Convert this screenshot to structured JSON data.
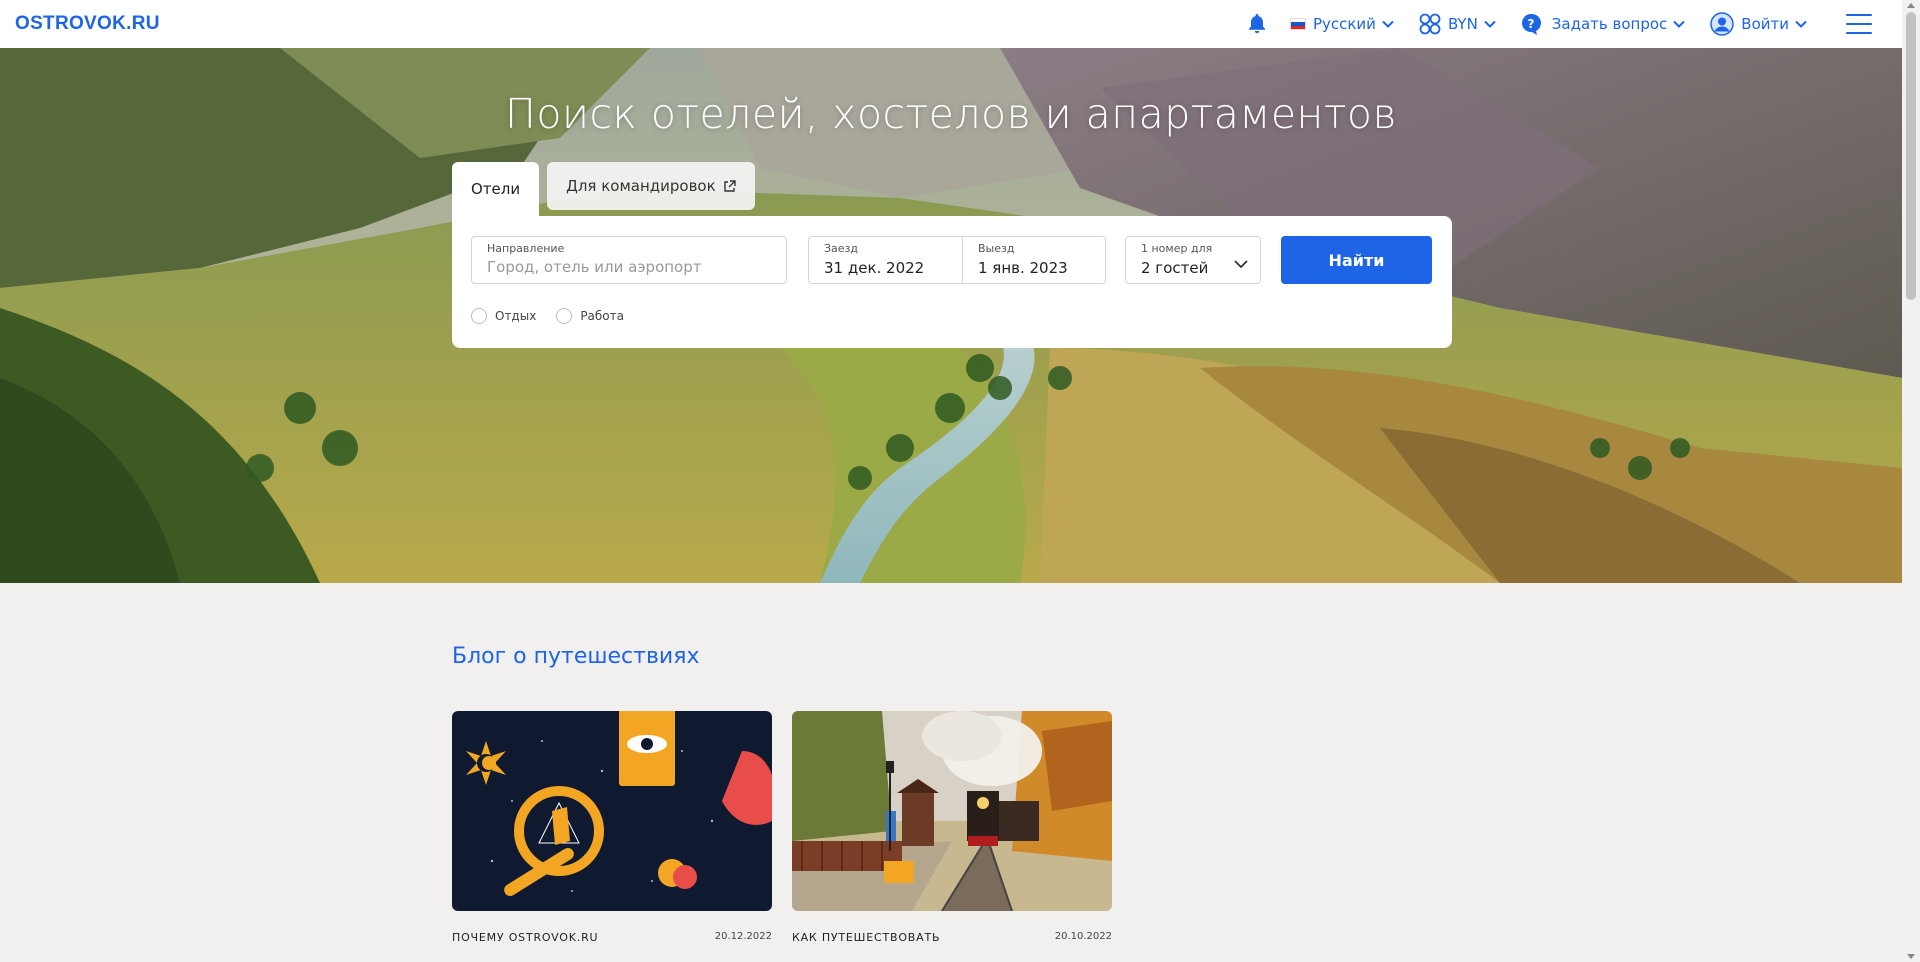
{
  "header": {
    "logo": "OSTROVOK.RU",
    "language": "Русский",
    "currency": "BYN",
    "help": "Задать вопрос",
    "login": "Войти"
  },
  "hero": {
    "title": "Поиск отелей, хостелов и апартаментов",
    "tabs": {
      "hotels": "Отели",
      "business": "Для командировок"
    }
  },
  "search": {
    "destination_label": "Направление",
    "destination_placeholder": "Город, отель или аэропорт",
    "checkin_label": "Заезд",
    "checkin_value": "31 дек. 2022",
    "checkout_label": "Выезд",
    "checkout_value": "1 янв. 2023",
    "guests_label": "1 номер для",
    "guests_value": "2 гостей",
    "find_button": "Найти",
    "purpose_leisure": "Отдых",
    "purpose_work": "Работа"
  },
  "blog": {
    "title": "Блог о путешествиях",
    "cards": [
      {
        "category": "ПОЧЕМУ OSTROVOK.RU",
        "date": "20.12.2022",
        "image": "astrology-illustration"
      },
      {
        "category": "КАК ПУТЕШЕСТВОВАТЬ",
        "date": "20.10.2022",
        "image": "steam-train-photo"
      }
    ]
  },
  "colors": {
    "brand": "#1d64e7",
    "page_bg": "#f1f0ef"
  }
}
